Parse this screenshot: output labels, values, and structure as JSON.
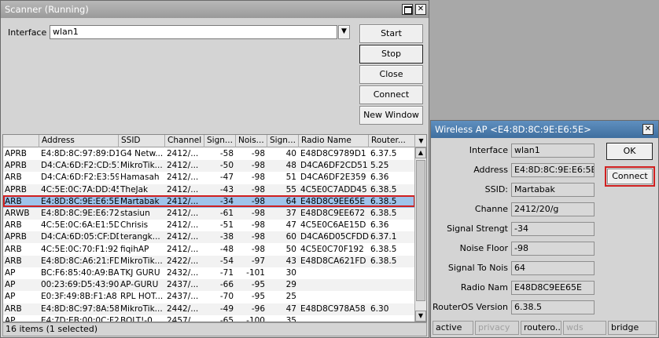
{
  "scanner": {
    "title": "Scanner (Running)",
    "interface_label": "Interface",
    "interface_value": "wlan1",
    "buttons": {
      "start": "Start",
      "stop": "Stop",
      "close": "Close",
      "connect": "Connect",
      "new_window": "New Window"
    },
    "columns": [
      "",
      "Address",
      "SSID",
      "Channel",
      "Sign...",
      "Nois...",
      "Sign...",
      "Radio Name",
      "Router..."
    ],
    "rows": [
      {
        "flags": "APRB",
        "address": "E4:8D:8C:97:89:D1",
        "ssid": "G4 Netw...",
        "channel": "2412/...",
        "signal": "-58",
        "noise": "-98",
        "snr": "40",
        "radio": "E48D8C9789D1",
        "ros": "6.37.5"
      },
      {
        "flags": "APRB",
        "address": "D4:CA:6D:F2:CD:51",
        "ssid": "MikroTik...",
        "channel": "2412/...",
        "signal": "-50",
        "noise": "-98",
        "snr": "48",
        "radio": "D4CA6DF2CD51",
        "ros": "5.25"
      },
      {
        "flags": "ARB",
        "address": "D4:CA:6D:F2:E3:59",
        "ssid": "Hamasah",
        "channel": "2412/...",
        "signal": "-47",
        "noise": "-98",
        "snr": "51",
        "radio": "D4CA6DF2E359",
        "ros": "6.36"
      },
      {
        "flags": "APRB",
        "address": "4C:5E:0C:7A:DD:45",
        "ssid": "TheJak",
        "channel": "2412/...",
        "signal": "-43",
        "noise": "-98",
        "snr": "55",
        "radio": "4C5E0C7ADD45",
        "ros": "6.38.5"
      },
      {
        "flags": "ARB",
        "address": "E4:8D:8C:9E:E6:5E",
        "ssid": "Martabak",
        "channel": "2412/...",
        "signal": "-34",
        "noise": "-98",
        "snr": "64",
        "radio": "E48D8C9EE65E",
        "ros": "6.38.5"
      },
      {
        "flags": "ARWB",
        "address": "E4:8D:8C:9E:E6:72",
        "ssid": "stasiun",
        "channel": "2412/...",
        "signal": "-61",
        "noise": "-98",
        "snr": "37",
        "radio": "E48D8C9EE672",
        "ros": "6.38.5"
      },
      {
        "flags": "ARB",
        "address": "4C:5E:0C:6A:E1:5D",
        "ssid": "Chrisis",
        "channel": "2412/...",
        "signal": "-51",
        "noise": "-98",
        "snr": "47",
        "radio": "4C5E0C6AE15D",
        "ros": "6.36"
      },
      {
        "flags": "APRB",
        "address": "D4:CA:6D:05:CF:DD",
        "ssid": "terangk...",
        "channel": "2412/...",
        "signal": "-38",
        "noise": "-98",
        "snr": "60",
        "radio": "D4CA6D05CFDD",
        "ros": "6.37.1"
      },
      {
        "flags": "ARB",
        "address": "4C:5E:0C:70:F1:92",
        "ssid": "fiqihAP",
        "channel": "2412/...",
        "signal": "-48",
        "noise": "-98",
        "snr": "50",
        "radio": "4C5E0C70F192",
        "ros": "6.38.5"
      },
      {
        "flags": "ARB",
        "address": "E4:8D:8C:A6:21:FD",
        "ssid": "MikroTik...",
        "channel": "2422/...",
        "signal": "-54",
        "noise": "-97",
        "snr": "43",
        "radio": "E48D8CA621FD",
        "ros": "6.38.5"
      },
      {
        "flags": "AP",
        "address": "BC:F6:85:40:A9:BA",
        "ssid": "TKJ GURU",
        "channel": "2432/...",
        "signal": "-71",
        "noise": "-101",
        "snr": "30",
        "radio": "",
        "ros": ""
      },
      {
        "flags": "AP",
        "address": "00:23:69:D5:43:90",
        "ssid": "AP-GURU",
        "channel": "2437/...",
        "signal": "-66",
        "noise": "-95",
        "snr": "29",
        "radio": "",
        "ros": ""
      },
      {
        "flags": "AP",
        "address": "E0:3F:49:8B:F1:A8",
        "ssid": "RPL HOT...",
        "channel": "2437/...",
        "signal": "-70",
        "noise": "-95",
        "snr": "25",
        "radio": "",
        "ros": ""
      },
      {
        "flags": "ARB",
        "address": "E4:8D:8C:97:8A:58",
        "ssid": "MikroTik...",
        "channel": "2442/...",
        "signal": "-49",
        "noise": "-96",
        "snr": "47",
        "radio": "E48D8C978A58",
        "ros": "6.30"
      },
      {
        "flags": "AP",
        "address": "E4:7D:EB:00:0C:F2",
        "ssid": "BOLT!-0...",
        "channel": "2457/...",
        "signal": "-65",
        "noise": "-100",
        "snr": "35",
        "radio": "",
        "ros": ""
      }
    ],
    "status": "16 items (1 selected)"
  },
  "wireless_ap": {
    "title": "Wireless AP <E4:8D:8C:9E:E6:5E>",
    "fields": [
      {
        "label": "Interface",
        "value": "wlan1"
      },
      {
        "label": "Address",
        "value": "E4:8D:8C:9E:E6:5E"
      },
      {
        "label": "SSID:",
        "value": "Martabak"
      },
      {
        "label": "Channe",
        "value": "2412/20/g"
      },
      {
        "label": "Signal Strengt",
        "value": "-34"
      },
      {
        "label": "Noise Floor",
        "value": "-98"
      },
      {
        "label": "Signal To Nois",
        "value": "64"
      },
      {
        "label": "Radio Nam",
        "value": "E48D8C9EE65E"
      },
      {
        "label": "RouterOS Version",
        "value": "6.38.5"
      }
    ],
    "buttons": {
      "ok": "OK",
      "connect": "Connect"
    },
    "status": [
      "active",
      "privacy",
      "routero...",
      "wds",
      "bridge"
    ]
  },
  "colors": {
    "selection": "#9ec3ea",
    "highlight": "#d02020",
    "titlebar_active": "#4f7faf"
  }
}
